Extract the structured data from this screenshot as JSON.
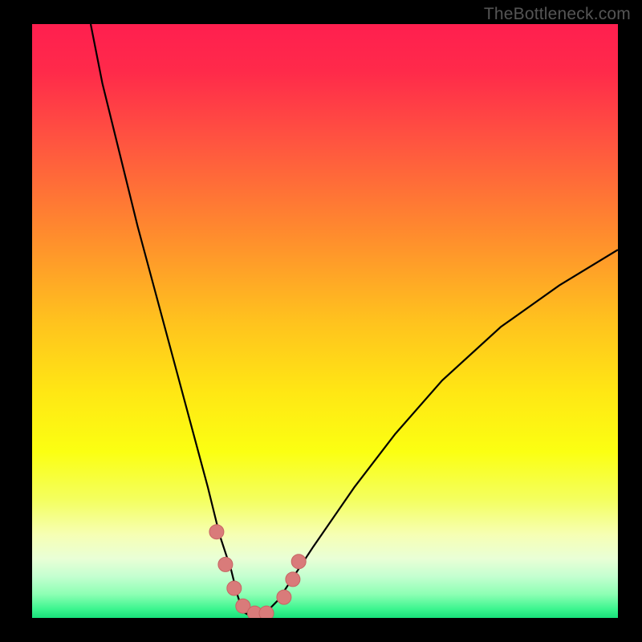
{
  "watermark": "TheBottleneck.com",
  "colors": {
    "frame": "#000000",
    "curve": "#000000",
    "marker_fill": "#d97b7a",
    "marker_stroke": "#c76463"
  },
  "gradient_stops": [
    {
      "offset": 0.0,
      "color": "#ff1f4f"
    },
    {
      "offset": 0.08,
      "color": "#ff2a4a"
    },
    {
      "offset": 0.2,
      "color": "#ff5540"
    },
    {
      "offset": 0.35,
      "color": "#ff8a2e"
    },
    {
      "offset": 0.5,
      "color": "#ffc21e"
    },
    {
      "offset": 0.62,
      "color": "#ffe714"
    },
    {
      "offset": 0.72,
      "color": "#fbff12"
    },
    {
      "offset": 0.8,
      "color": "#f4ff5e"
    },
    {
      "offset": 0.86,
      "color": "#f6ffb4"
    },
    {
      "offset": 0.9,
      "color": "#e9ffd6"
    },
    {
      "offset": 0.93,
      "color": "#c4ffd0"
    },
    {
      "offset": 0.96,
      "color": "#8dffb4"
    },
    {
      "offset": 0.985,
      "color": "#3cf58f"
    },
    {
      "offset": 1.0,
      "color": "#18e07a"
    }
  ],
  "chart_data": {
    "type": "line",
    "title": "",
    "xlabel": "",
    "ylabel": "",
    "xlim": [
      0,
      100
    ],
    "ylim": [
      0,
      100
    ],
    "series": [
      {
        "name": "bottleneck-curve",
        "x": [
          10,
          12,
          15,
          18,
          21,
          24,
          27,
          30,
          32,
          34,
          35,
          36,
          37,
          38,
          40,
          42,
          44,
          48,
          55,
          62,
          70,
          80,
          90,
          100
        ],
        "y": [
          100,
          90,
          78,
          66,
          55,
          44,
          33,
          22,
          14,
          8,
          4,
          1,
          0.5,
          0.5,
          1,
          3,
          6,
          12,
          22,
          31,
          40,
          49,
          56,
          62
        ]
      }
    ],
    "markers": {
      "name": "highlight-dots",
      "x": [
        31.5,
        33.0,
        34.5,
        36.0,
        38.0,
        40.0,
        43.0,
        44.5,
        45.5
      ],
      "y": [
        14.5,
        9.0,
        5.0,
        2.0,
        0.8,
        0.8,
        3.5,
        6.5,
        9.5
      ]
    }
  }
}
